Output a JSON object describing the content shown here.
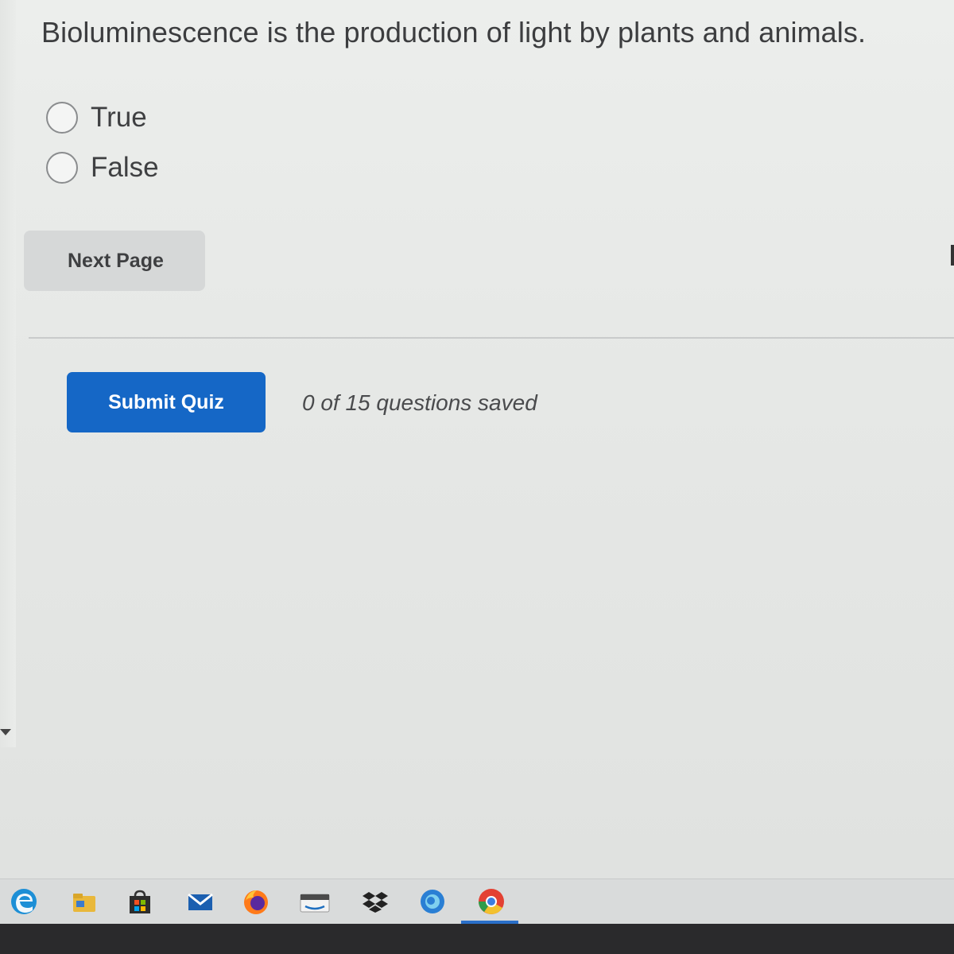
{
  "question": {
    "text": "Bioluminescence is the production of light by plants and animals."
  },
  "options": [
    {
      "label": "True",
      "selected": false
    },
    {
      "label": "False",
      "selected": false
    }
  ],
  "buttons": {
    "next_page": "Next Page",
    "submit_quiz": "Submit Quiz"
  },
  "status": {
    "saved": "0 of 15 questions saved"
  },
  "colors": {
    "primary": "#1567c6",
    "secondary_button": "#d6d8d8",
    "text": "#3c3d3f"
  },
  "taskbar": {
    "icons": [
      "edge-icon",
      "file-explorer-icon",
      "store-icon",
      "mail-icon",
      "firefox-icon",
      "amazon-icon",
      "dropbox-icon",
      "cortana-icon",
      "chrome-icon"
    ],
    "active_icon": "chrome-icon"
  }
}
